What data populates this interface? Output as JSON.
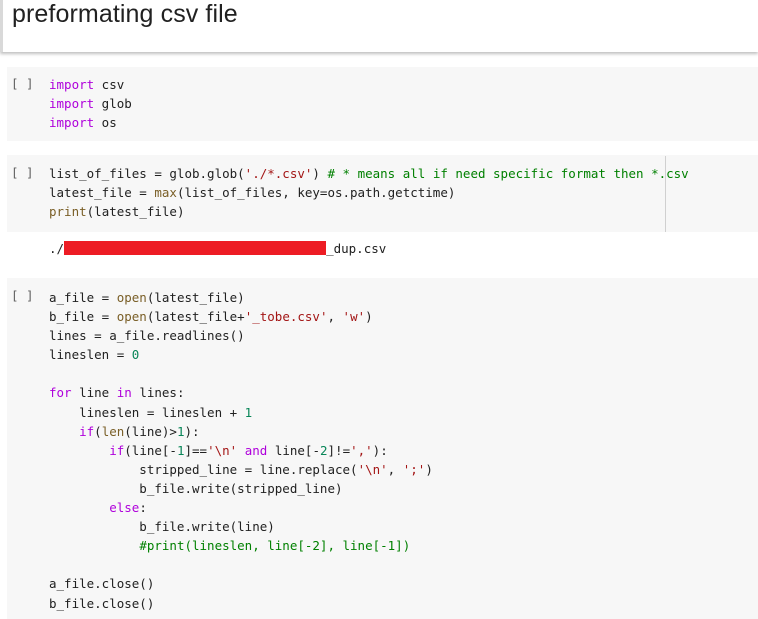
{
  "header": {
    "title": "preformating csv file"
  },
  "cells": [
    {
      "bracket": "[ ]",
      "lines": [
        "import csv",
        "import glob",
        "import os"
      ]
    },
    {
      "bracket": "[ ]",
      "lines": [
        "list_of_files = glob.glob('./*.csv') # * means all if need specific format then *.csv",
        "latest_file = max(list_of_files, key=os.path.getctime)",
        "print(latest_file)"
      ],
      "output": {
        "prefix": "./",
        "redacted": true,
        "suffix": "_dup.csv"
      }
    },
    {
      "bracket": "[ ]",
      "lines": [
        "a_file = open(latest_file)",
        "b_file = open(latest_file+'_tobe.csv', 'w')",
        "lines = a_file.readlines()",
        "lineslen = 0",
        "",
        "for line in lines:",
        "    lineslen = lineslen + 1",
        "    if(len(line)>1):",
        "        if(line[-1]=='\\n' and line[-2]!=','):",
        "            stripped_line = line.replace('\\n', ';')",
        "            b_file.write(stripped_line)",
        "        else:",
        "            b_file.write(line)",
        "            #print(lineslen, line[-2], line[-1])",
        "",
        "a_file.close()",
        "b_file.close()"
      ]
    }
  ],
  "colors": {
    "keyword": "#af00db",
    "string": "#a31515",
    "number": "#098658",
    "comment": "#008000",
    "redaction": "#ed1c24",
    "cell_background": "#f7f7f7"
  }
}
